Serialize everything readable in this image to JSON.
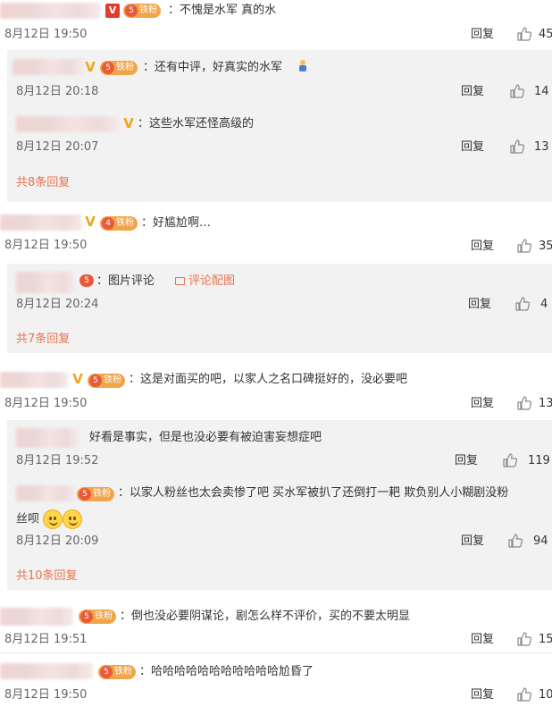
{
  "comments": [
    {
      "text": "：不愧是水军  真的水",
      "time": "8月12日 19:50",
      "reply": "回复",
      "likes": "45",
      "fan_badge": "铁粉",
      "fan_level": "5",
      "vip": "V",
      "replies": [
        {
          "text": "：还有中评，好真实的水军",
          "time": "8月12日 20:18",
          "reply": "回复",
          "likes": "14",
          "fan_badge": "铁粉",
          "fan_level": "5",
          "vip": "V"
        },
        {
          "text": "：这些水军还怪高级的",
          "time": "8月12日 20:07",
          "reply": "回复",
          "likes": "13",
          "vip": "V"
        }
      ],
      "more": "共8条回复"
    },
    {
      "text": "：好尴尬啊…",
      "time": "8月12日 19:50",
      "reply": "回复",
      "likes": "35",
      "fan_badge": "铁粉",
      "fan_level": "4",
      "vip": "V",
      "replies": [
        {
          "text": "：图片评论",
          "link": "评论配图",
          "time": "8月12日 20:24",
          "reply": "回复",
          "likes": "4",
          "fan_level": "5"
        }
      ],
      "more": "共7条回复"
    },
    {
      "text": "：这是对面买的吧，以家人之名口碑挺好的，没必要吧",
      "time": "8月12日 19:50",
      "reply": "回复",
      "likes": "13",
      "fan_badge": "铁粉",
      "fan_level": "5",
      "vip": "V",
      "replies": [
        {
          "text": "好看是事实，但是也没必要有被迫害妄想症吧",
          "time": "8月12日 19:52",
          "reply": "回复",
          "likes": "119"
        },
        {
          "text": "：以家人粉丝也太会卖惨了吧 买水军被扒了还倒打一耙 欺负别人小糊剧没粉",
          "text2": "丝呗",
          "time": "8月12日 20:09",
          "reply": "回复",
          "likes": "94",
          "fan_badge": "铁粉",
          "fan_level": "5"
        }
      ],
      "more": "共10条回复"
    },
    {
      "text": "：倒也没必要阴谋论，剧怎么样不评价，买的不要太明显",
      "time": "8月12日 19:51",
      "reply": "回复",
      "likes": "15",
      "fan_badge": "铁粉",
      "fan_level": "5"
    },
    {
      "text": "：哈哈哈哈哈哈哈哈哈哈哈尬昏了",
      "time": "8月12日 19:50",
      "reply": "回复",
      "likes": "10",
      "fan_badge": "铁粉",
      "fan_level": "5"
    }
  ],
  "colors": {
    "accent": "#eb7350",
    "panel": "#f2f2f2",
    "fan": "#f1a44a",
    "vip": "#f0a61a"
  }
}
